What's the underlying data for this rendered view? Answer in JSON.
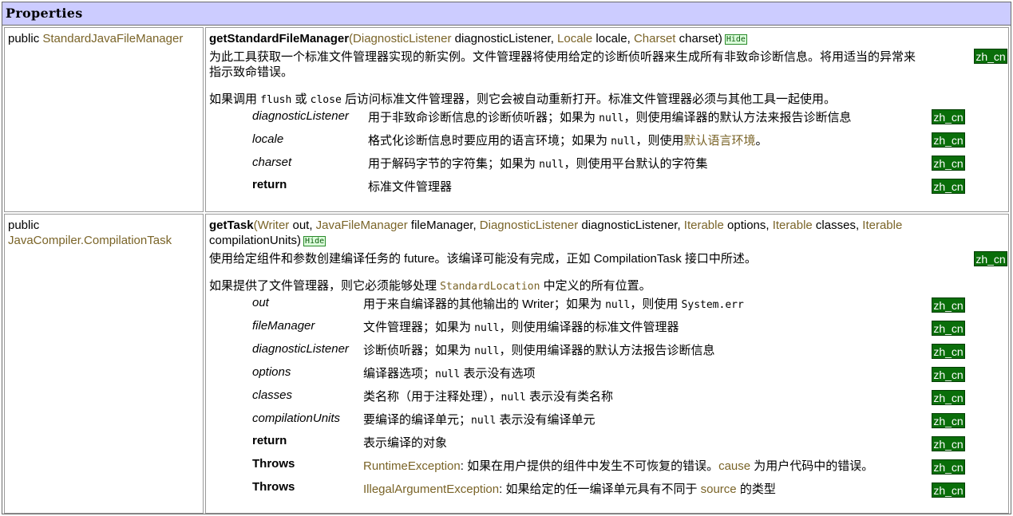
{
  "header": {
    "title": "Properties"
  },
  "methods": [
    {
      "modifier": "public",
      "return_type": "StandardJavaFileManager",
      "name": "getStandardFileManager",
      "sig": {
        "open": "(",
        "t1": "DiagnosticListener",
        "n1": " diagnosticListener, ",
        "t2": "Locale",
        "n2": " locale, ",
        "t3": "Charset",
        "n3": " charset)"
      },
      "hide": "Hide",
      "desc_line1": "为此工具获取一个标准文件管理器实现的新实例。文件管理器将使用给定的诊断侦听器来生成所有非致命诊断信息。将用适当的异常来",
      "desc_line2": "指示致命错误。",
      "note": {
        "p1": "如果调用 ",
        "c1": "flush",
        "p2": " 或 ",
        "c2": "close",
        "p3": " 后访问标准文件管理器，则它会被自动重新打开。标准文件管理器必须与其他工具一起使用。"
      },
      "zh": "zh_cn",
      "params": [
        {
          "name": "diagnosticListener",
          "d1": "用于非致命诊断信息的诊断侦听器；如果为 ",
          "code": "null",
          "d2": "，则使用编译器的默认方法来报告诊断信息"
        },
        {
          "name": "locale",
          "d1": "格式化诊断信息时要应用的语言环境；如果为 ",
          "code": "null",
          "d2": "，则使用",
          "link": "默认语言环境",
          "d3": "。"
        },
        {
          "name": "charset",
          "d1": "用于解码字节的字符集；如果为 ",
          "code": "null",
          "d2": "，则使用平台默认的字符集"
        },
        {
          "name": "return",
          "d1": "标准文件管理器"
        }
      ]
    },
    {
      "modifier": "public",
      "return_type": "JavaCompiler.CompilationTask",
      "name": "getTask",
      "sig": {
        "open": "(",
        "t1": "Writer",
        "n1": " out, ",
        "t2": "JavaFileManager",
        "n2": " fileManager, ",
        "t3": "DiagnosticListener",
        "n3": " diagnosticListener, ",
        "t4": "Iterable",
        "n4": " options, ",
        "t5": "Iterable",
        "n5": " classes, ",
        "t6": "Iterable",
        "line2": "compilationUnits)"
      },
      "hide": "Hide",
      "desc_line1": "使用给定组件和参数创建编译任务的 future。该编译可能没有完成，正如 CompilationTask 接口中所述。",
      "note": {
        "p1": "如果提供了文件管理器，则它必须能够处理 ",
        "c1": "StandardLocation",
        "p2": " 中定义的所有位置。"
      },
      "zh": "zh_cn",
      "params": [
        {
          "name": "out",
          "d1": "用于来自编译器的其他输出的 Writer；如果为 ",
          "code": "null",
          "d2": "，则使用 ",
          "code2": "System.err"
        },
        {
          "name": "fileManager",
          "d1": "文件管理器；如果为 ",
          "code": "null",
          "d2": "，则使用编译器的标准文件管理器"
        },
        {
          "name": "diagnosticListener",
          "d1": "诊断侦听器；如果为 ",
          "code": "null",
          "d2": "，则使用编译器的默认方法报告诊断信息"
        },
        {
          "name": "options",
          "d1": "编译器选项；",
          "code": "null",
          "d2": " 表示没有选项"
        },
        {
          "name": "classes",
          "d1": "类名称（用于注释处理），",
          "code": "null",
          "d2": " 表示没有类名称"
        },
        {
          "name": "compilationUnits",
          "d1": "要编译的编译单元；",
          "code": "null",
          "d2": " 表示没有编译单元"
        },
        {
          "name": "return",
          "d1": "表示编译的对象"
        },
        {
          "name": "Throws",
          "link": "RuntimeException",
          "d1": ": 如果在用户提供的组件中发生不可恢复的错误。",
          "link2": "cause",
          "d2": " 为用户代码中的错误。"
        },
        {
          "name": "Throws",
          "link": "IllegalArgumentException",
          "d1": ": 如果给定的任一编译单元具有不同于 ",
          "link2": "source",
          "d2": " 的类型"
        }
      ]
    }
  ]
}
